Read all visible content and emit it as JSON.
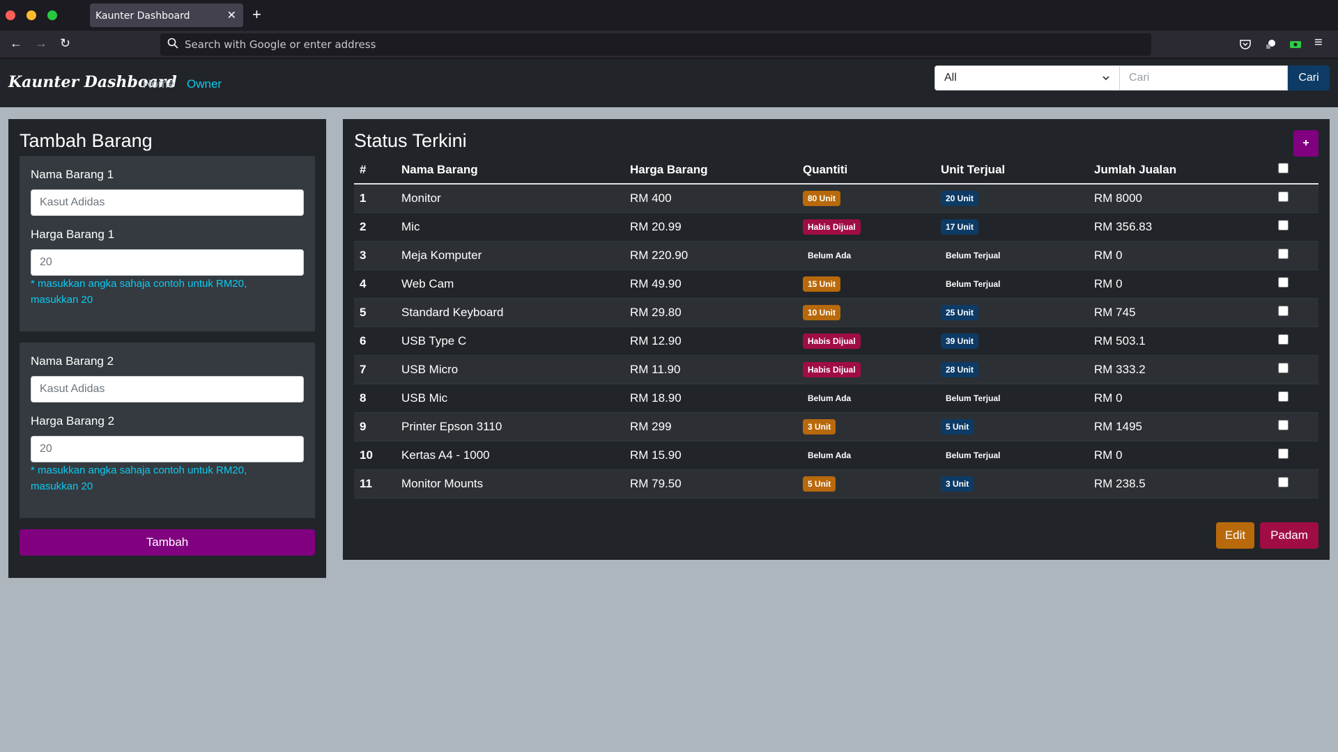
{
  "browser": {
    "tab_title": "Kaunter Dashboard",
    "tab_close": "✕",
    "new_tab": "+",
    "url_placeholder": "Search with Google or enter address",
    "back_icon": "←",
    "forward_icon": "→",
    "reload_icon": "↻",
    "menu_icon": "≡"
  },
  "nav": {
    "brand": "Kaunter Dashboard",
    "links": [
      "Home",
      "Owner"
    ],
    "filter_value": "All",
    "search_placeholder": "Cari",
    "search_button": "Cari"
  },
  "form": {
    "title": "Tambah Barang",
    "items": [
      {
        "name_label": "Nama Barang 1",
        "name_placeholder": "Kasut Adidas",
        "price_label": "Harga Barang 1",
        "price_placeholder": "20",
        "hint": "* masukkan angka sahaja contoh untuk RM20, masukkan 20"
      },
      {
        "name_label": "Nama Barang 2",
        "name_placeholder": "Kasut Adidas",
        "price_label": "Harga Barang 2",
        "price_placeholder": "20",
        "hint": "* masukkan angka sahaja contoh untuk RM20, masukkan 20"
      }
    ],
    "submit": "Tambah"
  },
  "status": {
    "title": "Status Terkini",
    "add_button": "+",
    "headers": [
      "#",
      "Nama Barang",
      "Harga Barang",
      "Quantiti",
      "Unit Terjual",
      "Jumlah Jualan"
    ],
    "rows": [
      {
        "no": "1",
        "name": "Monitor",
        "price": "RM 400",
        "qty": "80 Unit",
        "qty_type": "warn",
        "sold": "20 Unit",
        "sold_type": "info",
        "total": "RM 8000"
      },
      {
        "no": "2",
        "name": "Mic",
        "price": "RM 20.99",
        "qty": "Habis Dijual",
        "qty_type": "danger",
        "sold": "17 Unit",
        "sold_type": "info",
        "total": "RM 356.83"
      },
      {
        "no": "3",
        "name": "Meja Komputer",
        "price": "RM 220.90",
        "qty": "Belum Ada",
        "qty_type": "none",
        "sold": "Belum Terjual",
        "sold_type": "none",
        "total": "RM 0"
      },
      {
        "no": "4",
        "name": "Web Cam",
        "price": "RM 49.90",
        "qty": "15 Unit",
        "qty_type": "warn",
        "sold": "Belum Terjual",
        "sold_type": "none",
        "total": "RM 0"
      },
      {
        "no": "5",
        "name": "Standard Keyboard",
        "price": "RM 29.80",
        "qty": "10 Unit",
        "qty_type": "warn",
        "sold": "25 Unit",
        "sold_type": "info",
        "total": "RM 745"
      },
      {
        "no": "6",
        "name": "USB Type C",
        "price": "RM 12.90",
        "qty": "Habis Dijual",
        "qty_type": "danger",
        "sold": "39 Unit",
        "sold_type": "info",
        "total": "RM 503.1"
      },
      {
        "no": "7",
        "name": "USB Micro",
        "price": "RM 11.90",
        "qty": "Habis Dijual",
        "qty_type": "danger",
        "sold": "28 Unit",
        "sold_type": "info",
        "total": "RM 333.2"
      },
      {
        "no": "8",
        "name": "USB Mic",
        "price": "RM 18.90",
        "qty": "Belum Ada",
        "qty_type": "none",
        "sold": "Belum Terjual",
        "sold_type": "none",
        "total": "RM 0"
      },
      {
        "no": "9",
        "name": "Printer Epson 3110",
        "price": "RM 299",
        "qty": "3 Unit",
        "qty_type": "warn",
        "sold": "5 Unit",
        "sold_type": "info",
        "total": "RM 1495"
      },
      {
        "no": "10",
        "name": "Kertas A4 - 1000",
        "price": "RM 15.90",
        "qty": "Belum Ada",
        "qty_type": "none",
        "sold": "Belum Terjual",
        "sold_type": "none",
        "total": "RM 0"
      },
      {
        "no": "11",
        "name": "Monitor Mounts",
        "price": "RM 79.50",
        "qty": "5 Unit",
        "qty_type": "warn",
        "sold": "3 Unit",
        "sold_type": "info",
        "total": "RM 238.5"
      }
    ],
    "edit_button": "Edit",
    "delete_button": "Padam"
  },
  "colors": {
    "accent_purple": "#800080",
    "warning": "#b8690b",
    "danger": "#a00d45",
    "info": "#0d3b66",
    "link": "#0dcaf0"
  }
}
